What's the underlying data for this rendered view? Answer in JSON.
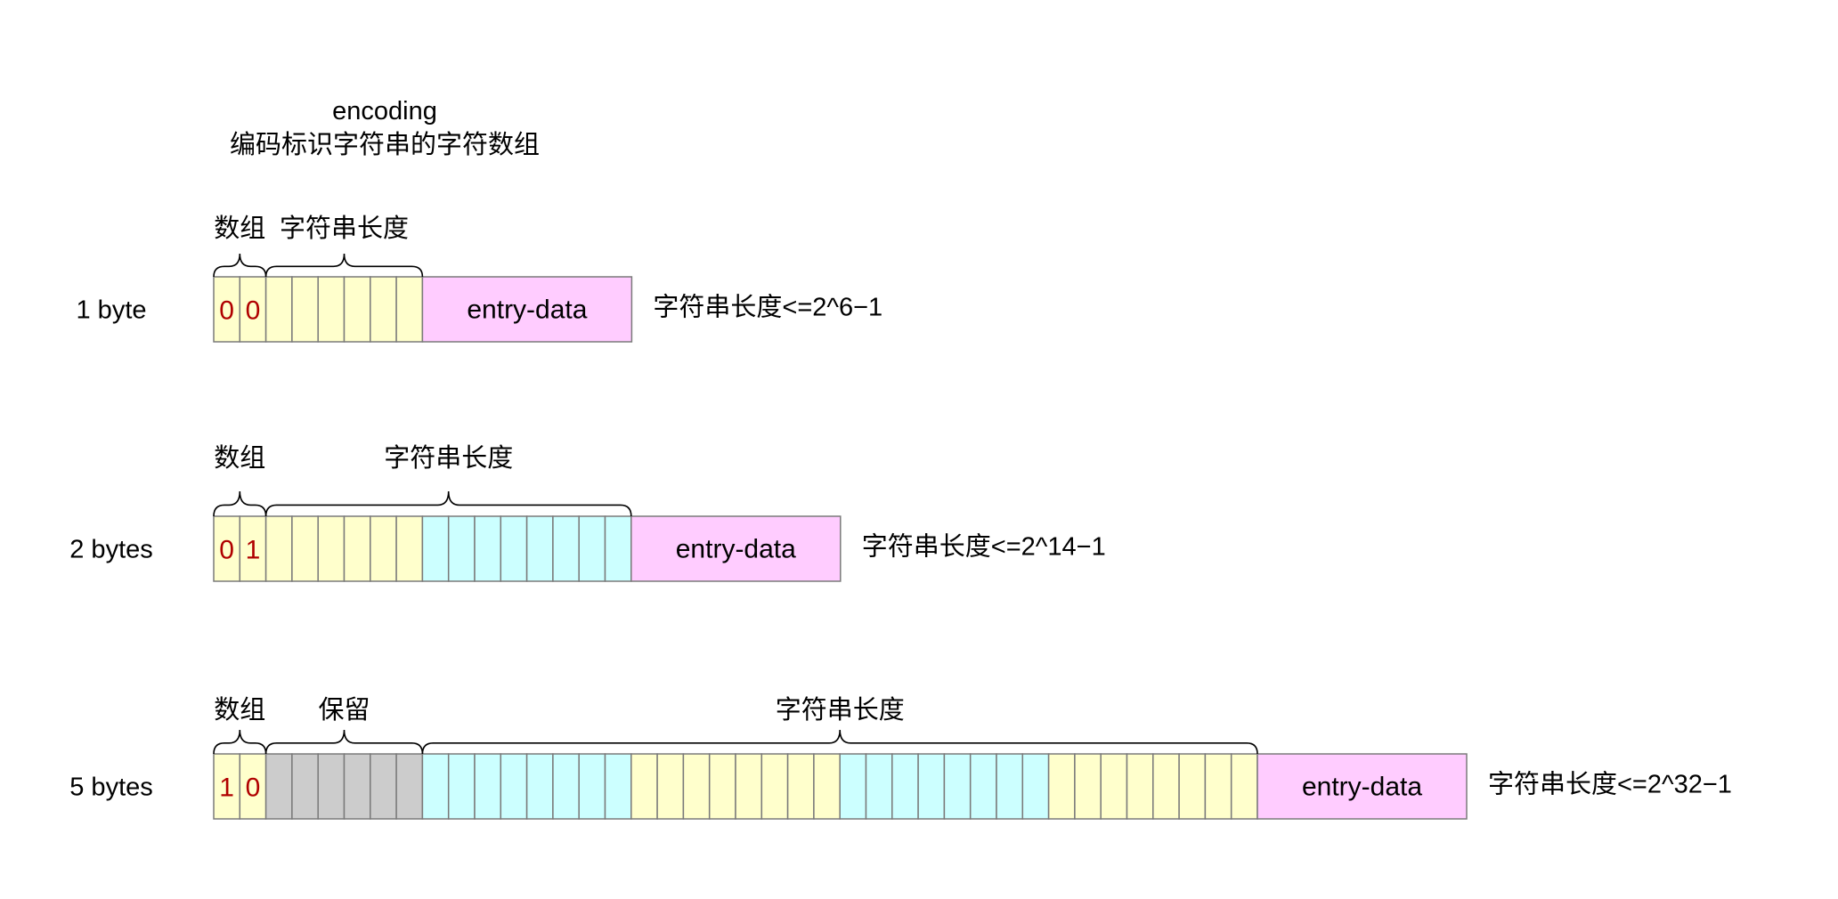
{
  "header": {
    "line1": "encoding",
    "line2": "编码标识字符串的字符数组"
  },
  "colors": {
    "yellow": "#ffffcc",
    "cyan": "#ccffff",
    "gray": "#cccccc",
    "pink": "#ffccff",
    "bit_text": "#b00000",
    "border": "#7a7a7a"
  },
  "rows": [
    {
      "label": "1 byte",
      "bits": [
        "0",
        "0"
      ],
      "groups": [
        {
          "color": "yellow",
          "count": 6
        }
      ],
      "braces": [
        {
          "label": "数组",
          "from": 0,
          "to": 2
        },
        {
          "label": "字符串长度",
          "from": 2,
          "to": 8
        }
      ],
      "entry": "entry-data",
      "note": "字符串长度<=2^6−1"
    },
    {
      "label": "2 bytes",
      "bits": [
        "0",
        "1"
      ],
      "groups": [
        {
          "color": "yellow",
          "count": 6
        },
        {
          "color": "cyan",
          "count": 8
        }
      ],
      "braces": [
        {
          "label": "数组",
          "from": 0,
          "to": 2
        },
        {
          "label": "字符串长度",
          "from": 2,
          "to": 16
        }
      ],
      "entry": "entry-data",
      "note": "字符串长度<=2^14−1"
    },
    {
      "label": "5 bytes",
      "bits": [
        "1",
        "0"
      ],
      "groups": [
        {
          "color": "gray",
          "count": 6
        },
        {
          "color": "cyan",
          "count": 8
        },
        {
          "color": "yellow",
          "count": 8
        },
        {
          "color": "cyan",
          "count": 8
        },
        {
          "color": "yellow",
          "count": 8
        }
      ],
      "braces": [
        {
          "label": "数组",
          "from": 0,
          "to": 2
        },
        {
          "label": "保留",
          "from": 2,
          "to": 8
        },
        {
          "label": "字符串长度",
          "from": 8,
          "to": 40
        }
      ],
      "entry": "entry-data",
      "note": "字符串长度<=2^32−1"
    }
  ]
}
